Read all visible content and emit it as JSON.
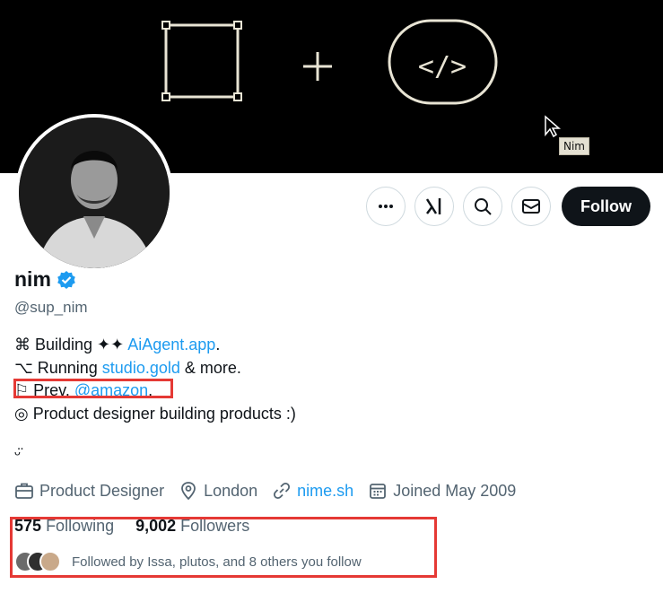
{
  "banner": {
    "cursor_tooltip": "Nim",
    "code_symbol": "</>"
  },
  "profile": {
    "name": "nim",
    "handle": "@sup_nim",
    "bio": {
      "line1": {
        "prefix": "⌘ Building ✦✦ ",
        "link": "AiAgent.app",
        "suffix": "."
      },
      "line2": {
        "prefix": "⌥ Running ",
        "link": "studio.gold",
        "suffix": " & more."
      },
      "line3": {
        "prefix": "⚐ Prev. ",
        "link": "@amazon",
        "suffix": "."
      },
      "line4": " ◎ Product designer building products :)",
      "line5": "ᵕ̈"
    },
    "meta": {
      "profession": "Product Designer",
      "location": "London",
      "website": "nime.sh",
      "joined": "Joined May 2009"
    },
    "stats": {
      "following_count": "575",
      "following_label": "Following",
      "followers_count": "9,002",
      "followers_label": "Followers"
    },
    "followed_by": "Followed by Issa, plutos, and 8 others you follow"
  },
  "actions": {
    "follow_label": "Follow"
  },
  "colors": {
    "accent": "#1d9bf0",
    "annotation": "#e53935",
    "text": "#0f1419",
    "secondary": "#536471"
  }
}
